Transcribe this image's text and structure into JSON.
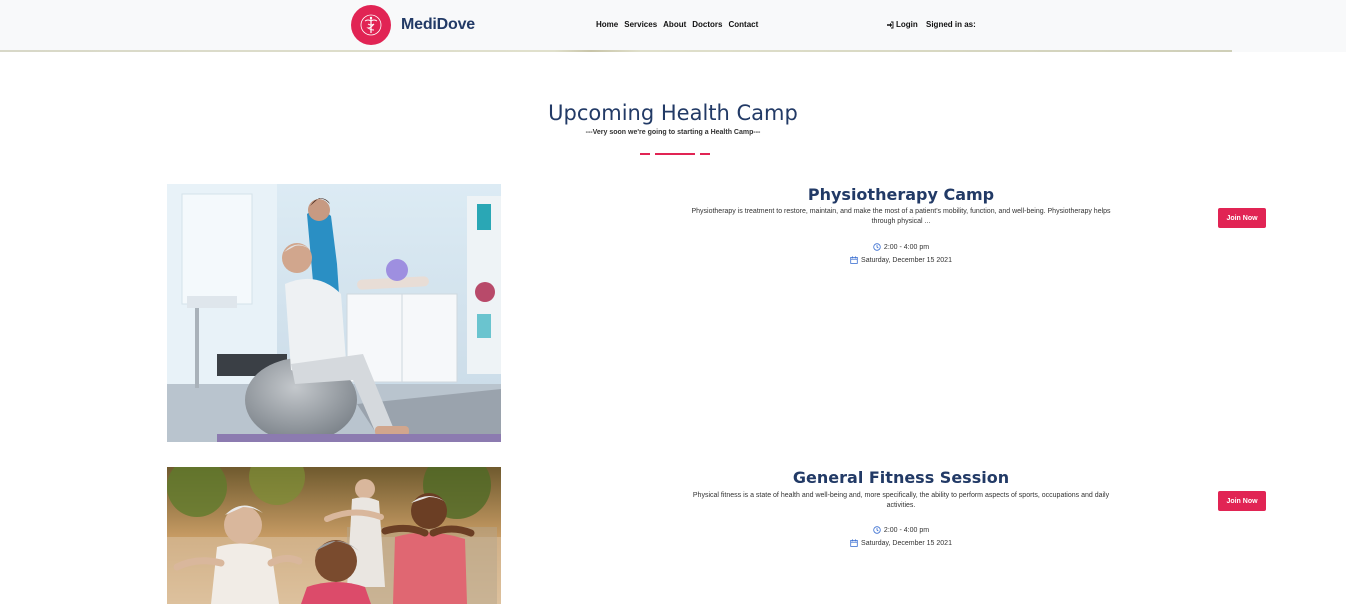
{
  "brand": {
    "name": "MediDove",
    "accent": "#e12454",
    "primary": "#223a66"
  },
  "nav": {
    "links": [
      "Home",
      "Services",
      "About",
      "Doctors",
      "Contact"
    ],
    "login_label": "Login",
    "signed_in_label": "Signed in as:"
  },
  "section": {
    "title": "Upcoming Health Camp",
    "subtitle": "---Very soon we're going to starting a Health Camp---"
  },
  "camps": [
    {
      "title": "Physiotherapy Camp",
      "description": "Physiotherapy is treatment to restore, maintain, and make the most of a patient's mobility, function, and well-being. Physiotherapy helps through physical ...",
      "time": "2:00 - 4:00 pm",
      "date": "Saturday, December 15 2021",
      "button": "Join Now",
      "image": "physiotherapy-ball-photo"
    },
    {
      "title": "General Fitness Session",
      "description": "Physical fitness is a state of health and well-being and, more specifically, the ability to perform aspects of sports, occupations and daily activities.",
      "time": "2:00 - 4:00 pm",
      "date": "Saturday, December 15 2021",
      "button": "Join Now",
      "image": "seniors-stretching-photo"
    }
  ]
}
